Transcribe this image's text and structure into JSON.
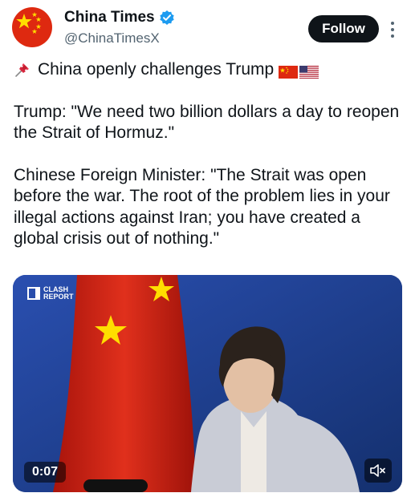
{
  "author": {
    "display_name": "China Times",
    "handle": "@ChinaTimesX",
    "avatar_icon": "china-flag-avatar",
    "verified_icon": "verified-badge-icon"
  },
  "actions": {
    "follow_label": "Follow",
    "more_icon": "more-vertical-icon"
  },
  "post": {
    "headline": "China openly challenges Trump",
    "headline_icons": [
      "pushpin-icon",
      "china-flag-icon",
      "us-flag-icon"
    ],
    "quote_1": "Trump: \"We need two billion dollars a day to reopen the Strait of Hormuz.\"",
    "quote_2": "Chinese Foreign Minister: \"The Strait was open before the war. The root of the problem lies in your illegal actions against Iran; you have created a global crisis out of nothing.\""
  },
  "video": {
    "brand_line_1": "CLASH",
    "brand_line_2": "REPORT",
    "duration": "0:07",
    "mute_icon": "muted-speaker-icon"
  },
  "colors": {
    "follow_bg": "#0f1419",
    "handle": "#536471",
    "verified": "#1d9bf0",
    "flag_red": "#de2910",
    "flag_yellow": "#ffde00",
    "video_bg": "#1a3b8c"
  }
}
